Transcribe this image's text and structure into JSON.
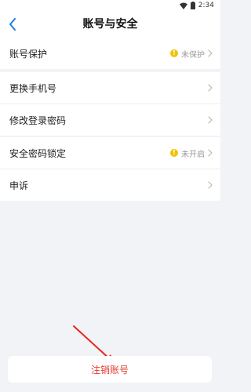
{
  "status_bar": {
    "time": "2:34"
  },
  "header": {
    "title": "账号与安全"
  },
  "groups": [
    {
      "items": [
        {
          "label": "账号保护",
          "status": "未保护",
          "warning_icon": "!"
        }
      ]
    },
    {
      "items": [
        {
          "label": "更换手机号"
        },
        {
          "label": "修改登录密码"
        }
      ]
    },
    {
      "items": [
        {
          "label": "安全密码锁定",
          "status": "未开启",
          "warning_icon": "!"
        },
        {
          "label": "申诉"
        }
      ]
    }
  ],
  "footer": {
    "cancel_account_label": "注销账号"
  },
  "colors": {
    "accent": "#1e7fe0",
    "warning": "#f2c200",
    "danger": "#e23a2e",
    "background": "#f1f3f6"
  },
  "icons": {
    "back": "chevron-left-icon",
    "row_arrow": "chevron-right-icon",
    "wifi": "wifi-icon",
    "battery": "battery-icon"
  }
}
